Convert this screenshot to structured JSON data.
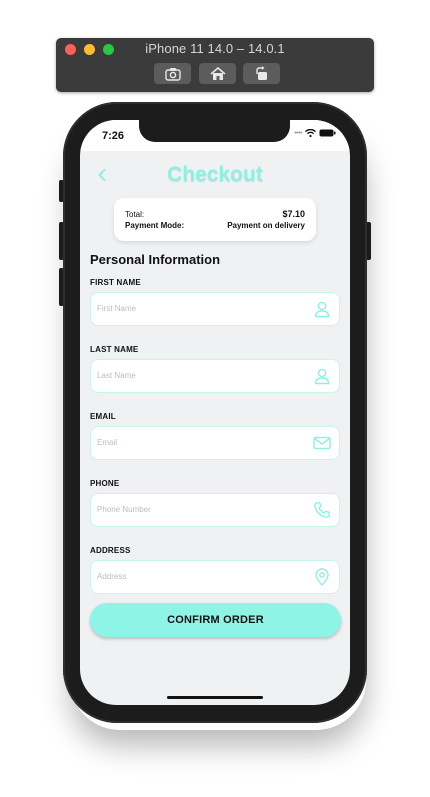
{
  "simulator": {
    "title": "iPhone 11 14.0 – 14.0.1",
    "buttons": [
      "screenshot-icon",
      "home-icon",
      "rotate-icon"
    ]
  },
  "status_bar": {
    "time": "7:26",
    "icons": [
      "cellular-dots-icon",
      "wifi-icon",
      "battery-icon"
    ]
  },
  "header": {
    "back_icon": "chevron-left-icon",
    "title": "Checkout"
  },
  "summary": {
    "total_label": "Total:",
    "total_value": "$7.10",
    "payment_label": "Payment Mode:",
    "payment_value": "Payment on delivery"
  },
  "form": {
    "section_title": "Personal Information",
    "fields": [
      {
        "label": "FIRST NAME",
        "placeholder": "First Name",
        "icon": "user-icon"
      },
      {
        "label": "LAST NAME",
        "placeholder": "Last Name",
        "icon": "user-icon"
      },
      {
        "label": "EMAIL",
        "placeholder": "Email",
        "icon": "mail-icon"
      },
      {
        "label": "PHONE",
        "placeholder": "Phone Number",
        "icon": "phone-icon"
      },
      {
        "label": "ADDRESS",
        "placeholder": "Address",
        "icon": "location-pin-icon"
      }
    ],
    "confirm_label": "CONFIRM ORDER"
  },
  "colors": {
    "accent": "#8ef5e6",
    "field_border": "#c9f4ec",
    "screen_background": "#eff1f3"
  }
}
